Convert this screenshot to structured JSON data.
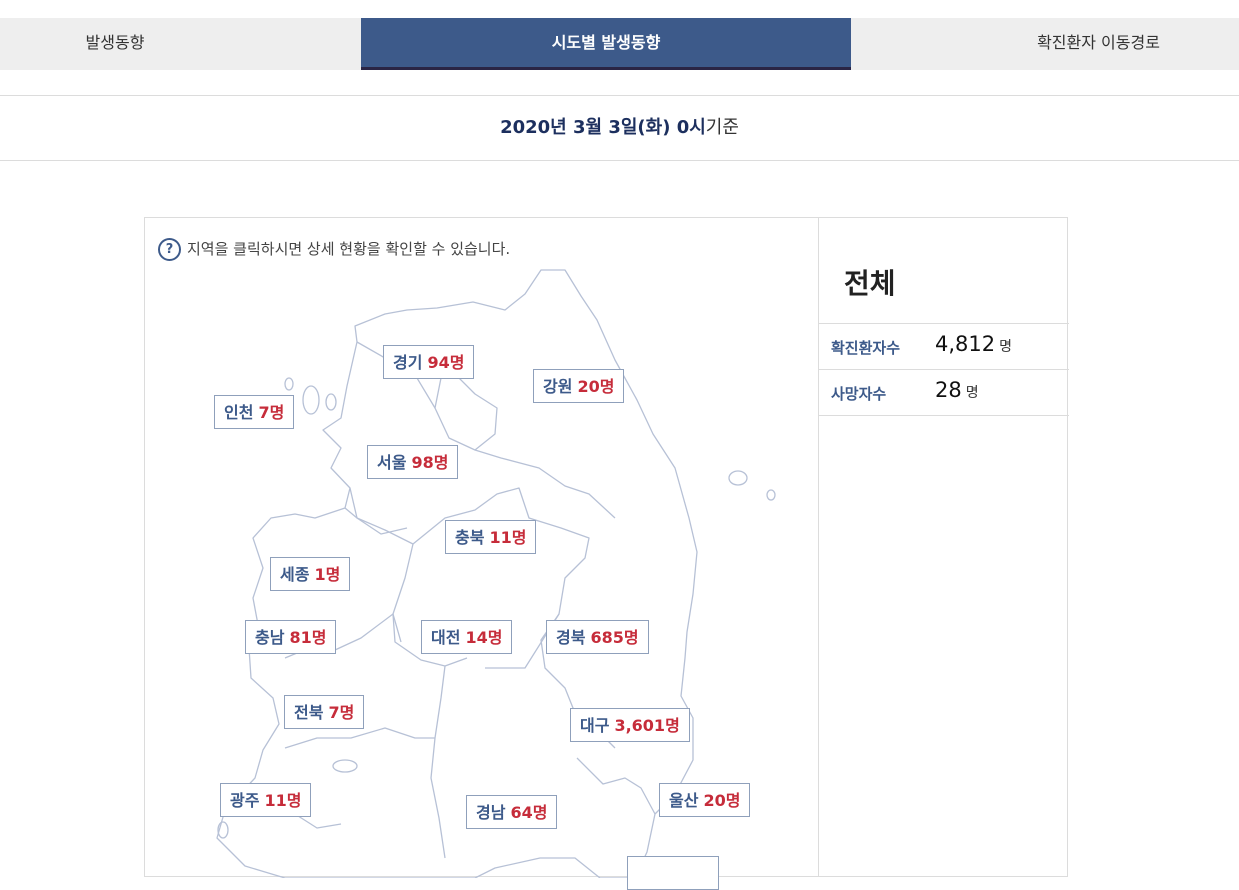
{
  "tabs": [
    {
      "label": "발생동향"
    },
    {
      "label": "시도별 발생동향",
      "active": true
    },
    {
      "label": "확진환자 이동경로"
    }
  ],
  "date": {
    "strong": "2020년 3월 3일(화) 0시",
    "suffix": "기준"
  },
  "hint": {
    "icon": "question-icon",
    "glyph": "?",
    "text": "지역을 클릭하시면 상세 현황을 확인할 수 있습니다."
  },
  "summary": {
    "title": "전체",
    "confirmed_label": "확진환자수",
    "confirmed_value": "4,812",
    "deaths_label": "사망자수",
    "deaths_value": "28",
    "unit": "명"
  },
  "regions": [
    {
      "name": "경기",
      "count": "94명"
    },
    {
      "name": "강원",
      "count": "20명"
    },
    {
      "name": "인천",
      "count": "7명"
    },
    {
      "name": "서울",
      "count": "98명"
    },
    {
      "name": "충북",
      "count": "11명"
    },
    {
      "name": "세종",
      "count": "1명"
    },
    {
      "name": "충남",
      "count": "81명"
    },
    {
      "name": "대전",
      "count": "14명"
    },
    {
      "name": "경북",
      "count": "685명"
    },
    {
      "name": "전북",
      "count": "7명"
    },
    {
      "name": "대구",
      "count": "3,601명"
    },
    {
      "name": "광주",
      "count": "11명"
    },
    {
      "name": "경남",
      "count": "64명"
    },
    {
      "name": "울산",
      "count": "20명"
    }
  ],
  "colors": {
    "accent": "#3d5a8a",
    "count": "#c62c3a",
    "map_line": "#b7c1d6"
  }
}
